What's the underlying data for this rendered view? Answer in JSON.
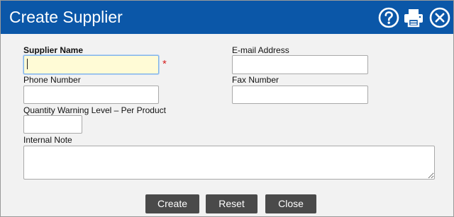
{
  "dialog": {
    "title": "Create Supplier",
    "icons": [
      "help-icon",
      "print-icon",
      "close-icon"
    ]
  },
  "form": {
    "supplier_name": {
      "label": "Supplier Name",
      "value": "",
      "required_marker": "*"
    },
    "email": {
      "label": "E-mail Address",
      "value": ""
    },
    "phone": {
      "label": "Phone Number",
      "value": ""
    },
    "fax": {
      "label": "Fax Number",
      "value": ""
    },
    "quantity_warning": {
      "label": "Quantity Warning Level – Per Product",
      "value": ""
    },
    "internal_note": {
      "label": "Internal Note",
      "value": ""
    }
  },
  "buttons": {
    "create": "Create",
    "reset": "Reset",
    "close": "Close"
  },
  "colors": {
    "titlebar": "#0b57a8",
    "background": "#f2f2f2",
    "button": "#4a4a4a",
    "focused_field": "#fffbd6",
    "required": "#d62020"
  }
}
